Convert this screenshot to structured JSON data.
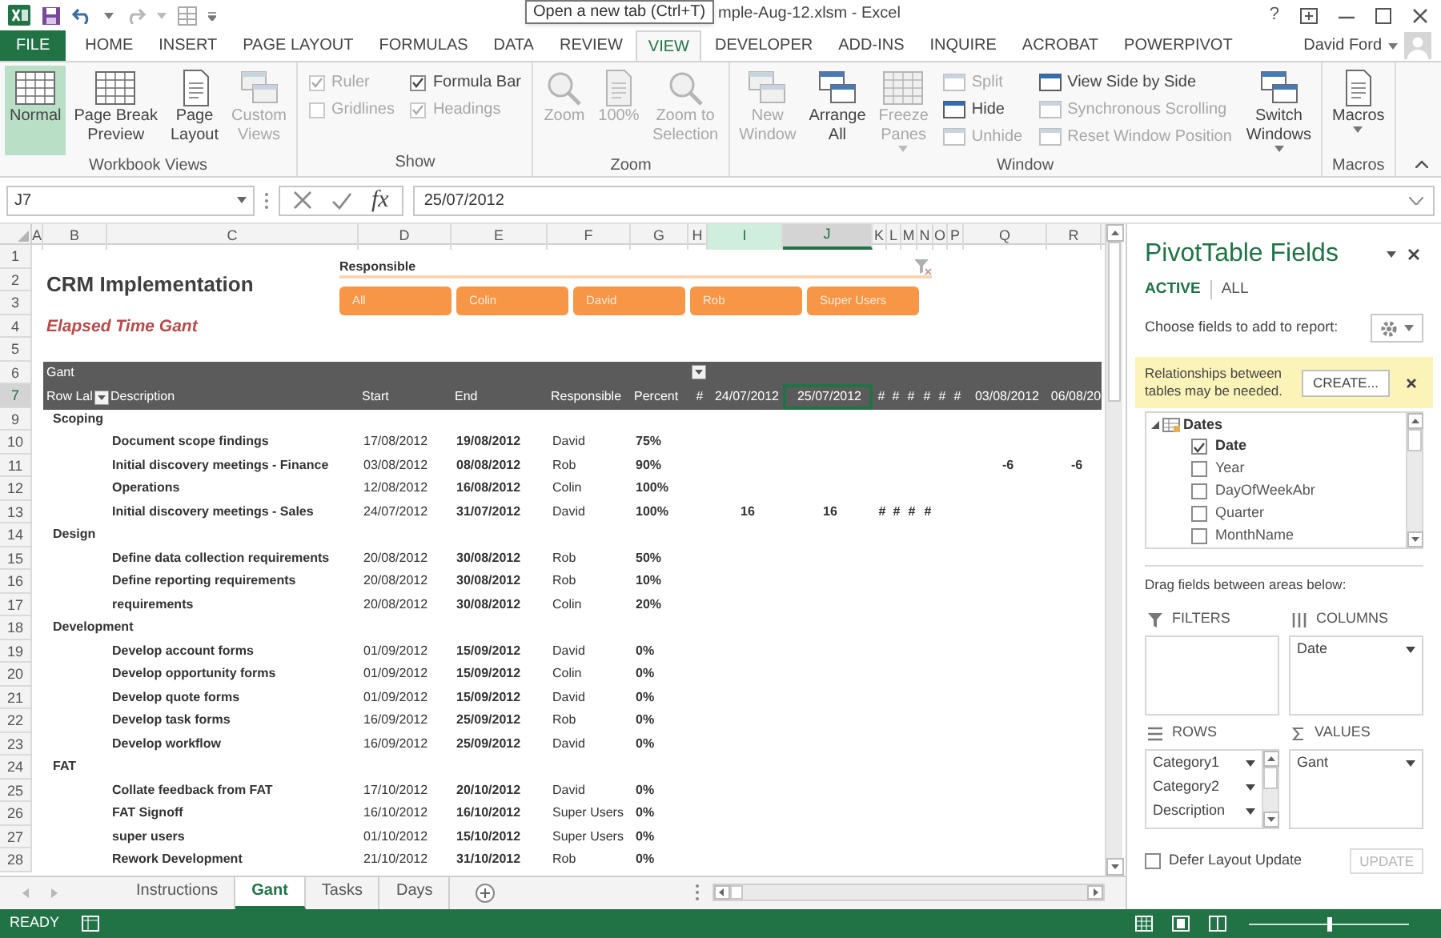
{
  "title_bar": {
    "tooltip": "Open a new tab (Ctrl+T)",
    "title": "mple-Aug-12.xlsm - Excel",
    "help": "?"
  },
  "tabs": [
    {
      "label": "FILE",
      "kind": "file",
      "selected": false
    },
    {
      "label": "HOME",
      "kind": "tab",
      "selected": false
    },
    {
      "label": "INSERT",
      "kind": "tab",
      "selected": false
    },
    {
      "label": "PAGE LAYOUT",
      "kind": "tab",
      "selected": false
    },
    {
      "label": "FORMULAS",
      "kind": "tab",
      "selected": false
    },
    {
      "label": "DATA",
      "kind": "tab",
      "selected": false
    },
    {
      "label": "REVIEW",
      "kind": "tab",
      "selected": false
    },
    {
      "label": "VIEW",
      "kind": "tab",
      "selected": true
    },
    {
      "label": "DEVELOPER",
      "kind": "tab",
      "selected": false
    },
    {
      "label": "ADD-INS",
      "kind": "tab",
      "selected": false
    },
    {
      "label": "INQUIRE",
      "kind": "tab",
      "selected": false
    },
    {
      "label": "ACROBAT",
      "kind": "tab",
      "selected": false
    },
    {
      "label": "POWERPIVOT",
      "kind": "tab",
      "selected": false
    }
  ],
  "user": {
    "name": "David Ford"
  },
  "ribbon": {
    "groups": [
      {
        "label": "Workbook Views",
        "items": [
          {
            "kind": "large",
            "lines": [
              "Normal"
            ],
            "selected": true,
            "disabled": false
          },
          {
            "kind": "large",
            "lines": [
              "Page Break",
              "Preview"
            ],
            "selected": false,
            "disabled": false
          },
          {
            "kind": "large",
            "lines": [
              "Page",
              "Layout"
            ],
            "selected": false,
            "disabled": false
          },
          {
            "kind": "large",
            "lines": [
              "Custom",
              "Views"
            ],
            "selected": false,
            "disabled": true
          }
        ]
      },
      {
        "label": "Show",
        "items": [
          {
            "kind": "checkbox",
            "label": "Ruler",
            "checked": true,
            "disabled": true
          },
          {
            "kind": "checkbox",
            "label": "Gridlines",
            "checked": false,
            "disabled": true
          },
          {
            "kind": "checkbox",
            "label": "Formula Bar",
            "checked": true,
            "disabled": false
          },
          {
            "kind": "checkbox",
            "label": "Headings",
            "checked": true,
            "disabled": true
          }
        ]
      },
      {
        "label": "Zoom",
        "items": [
          {
            "kind": "large",
            "lines": [
              "Zoom"
            ],
            "selected": false,
            "disabled": true
          },
          {
            "kind": "large",
            "lines": [
              "100%"
            ],
            "selected": false,
            "disabled": true
          },
          {
            "kind": "large",
            "lines": [
              "Zoom to",
              "Selection"
            ],
            "selected": false,
            "disabled": true
          }
        ]
      },
      {
        "label": "Window",
        "items": [
          {
            "kind": "large",
            "lines": [
              "New",
              "Window"
            ],
            "selected": false,
            "disabled": true
          },
          {
            "kind": "large",
            "lines": [
              "Arrange",
              "All"
            ],
            "selected": false,
            "disabled": false
          },
          {
            "kind": "large",
            "lines": [
              "Freeze",
              "Panes"
            ],
            "selected": false,
            "disabled": true,
            "dropdown": true
          },
          {
            "kind": "small",
            "label": "Split",
            "disabled": true
          },
          {
            "kind": "small",
            "label": "Hide",
            "disabled": false
          },
          {
            "kind": "small",
            "label": "Unhide",
            "disabled": true
          },
          {
            "kind": "small",
            "label": "View Side by Side",
            "disabled": false
          },
          {
            "kind": "small",
            "label": "Synchronous Scrolling",
            "disabled": true
          },
          {
            "kind": "small",
            "label": "Reset Window Position",
            "disabled": true
          },
          {
            "kind": "large",
            "lines": [
              "Switch",
              "Windows"
            ],
            "selected": false,
            "disabled": false,
            "dropdown": true
          }
        ]
      },
      {
        "label": "Macros",
        "items": [
          {
            "kind": "large",
            "lines": [
              "Macros"
            ],
            "selected": false,
            "disabled": false,
            "dropdown": true
          }
        ]
      }
    ]
  },
  "formula_bar": {
    "name_box": "J7",
    "function_label": "fx",
    "value": "25/07/2012"
  },
  "slicer": {
    "title": "Responsible",
    "buttons": [
      {
        "label": "All",
        "selected": true
      },
      {
        "label": "Colin",
        "selected": true
      },
      {
        "label": "David",
        "selected": true
      },
      {
        "label": "Rob",
        "selected": true
      },
      {
        "label": "Super Users",
        "selected": true
      }
    ]
  },
  "sheet": {
    "columns": [
      {
        "label": "A",
        "selected": false,
        "highlighted": false
      },
      {
        "label": "B",
        "selected": false,
        "highlighted": false
      },
      {
        "label": "C",
        "selected": false,
        "highlighted": false
      },
      {
        "label": "D",
        "selected": false,
        "highlighted": false
      },
      {
        "label": "E",
        "selected": false,
        "highlighted": false
      },
      {
        "label": "F",
        "selected": false,
        "highlighted": false
      },
      {
        "label": "G",
        "selected": false,
        "highlighted": false
      },
      {
        "label": "H",
        "selected": false,
        "highlighted": false
      },
      {
        "label": "I",
        "selected": false,
        "highlighted": true
      },
      {
        "label": "J",
        "selected": true,
        "highlighted": false
      },
      {
        "label": "K",
        "selected": false,
        "highlighted": false
      },
      {
        "label": "L",
        "selected": false,
        "highlighted": false
      },
      {
        "label": "M",
        "selected": false,
        "highlighted": false
      },
      {
        "label": "N",
        "selected": false,
        "highlighted": false
      },
      {
        "label": "O",
        "selected": false,
        "highlighted": false
      },
      {
        "label": "P",
        "selected": false,
        "highlighted": false
      },
      {
        "label": "Q",
        "selected": false,
        "highlighted": false
      },
      {
        "label": "R",
        "selected": false,
        "highlighted": false
      }
    ],
    "rows": [
      {
        "number": "1",
        "kind": "blank",
        "selected": false
      },
      {
        "number": "2",
        "kind": "title",
        "selected": false,
        "b": "CRM Implementation"
      },
      {
        "number": "3",
        "kind": "blank",
        "selected": false
      },
      {
        "number": "4",
        "kind": "subtitle",
        "selected": false,
        "b": "Elapsed Time Gant"
      },
      {
        "number": "5",
        "kind": "blank",
        "selected": false
      },
      {
        "number": "6",
        "kind": "header_top",
        "selected": false,
        "b": "Gant"
      },
      {
        "number": "7",
        "kind": "header",
        "selected": true,
        "b": "Row Lal",
        "c": "Description",
        "d": "Start",
        "e": "End",
        "f": "Responsible",
        "g": "Percent",
        "h": "#",
        "i": "24/07/2012",
        "j": "25/07/2012",
        "k": "#",
        "l": "#",
        "m": "#",
        "n": "#",
        "o": "#",
        "p": "#",
        "q": "03/08/2012",
        "r": "06/08/20"
      },
      {
        "number": "9",
        "kind": "group",
        "selected": false,
        "b": "Scoping"
      },
      {
        "number": "10",
        "kind": "task",
        "selected": false,
        "c": "Document scope findings",
        "d": "17/08/2012",
        "e": "19/08/2012",
        "f": "David",
        "g": "75%"
      },
      {
        "number": "11",
        "kind": "task",
        "selected": false,
        "c": "Initial discovery meetings - Finance",
        "d": "03/08/2012",
        "e": "08/08/2012",
        "f": "Rob",
        "g": "90%",
        "q": "-6",
        "r": "-6"
      },
      {
        "number": "12",
        "kind": "task",
        "selected": false,
        "c": "Operations",
        "d": "12/08/2012",
        "e": "16/08/2012",
        "f": "Colin",
        "g": "100%"
      },
      {
        "number": "13",
        "kind": "task",
        "selected": false,
        "c": "Initial discovery meetings - Sales",
        "d": "24/07/2012",
        "e": "31/07/2012",
        "f": "David",
        "g": "100%",
        "i": "16",
        "j": "16",
        "k": "#",
        "l": "#",
        "m": "#",
        "n": "#"
      },
      {
        "number": "14",
        "kind": "group",
        "selected": false,
        "b": "Design"
      },
      {
        "number": "15",
        "kind": "task",
        "selected": false,
        "c": "Define data collection requirements",
        "d": "20/08/2012",
        "e": "30/08/2012",
        "f": "Rob",
        "g": "50%"
      },
      {
        "number": "16",
        "kind": "task",
        "selected": false,
        "c": "Define reporting requirements",
        "d": "20/08/2012",
        "e": "30/08/2012",
        "f": "Rob",
        "g": "10%"
      },
      {
        "number": "17",
        "kind": "task",
        "selected": false,
        "c": "requirements",
        "d": "20/08/2012",
        "e": "30/08/2012",
        "f": "Colin",
        "g": "20%"
      },
      {
        "number": "18",
        "kind": "group",
        "selected": false,
        "b": "Development"
      },
      {
        "number": "19",
        "kind": "task",
        "selected": false,
        "c": "Develop account forms",
        "d": "01/09/2012",
        "e": "15/09/2012",
        "f": "David",
        "g": "0%"
      },
      {
        "number": "20",
        "kind": "task",
        "selected": false,
        "c": "Develop opportunity forms",
        "d": "01/09/2012",
        "e": "15/09/2012",
        "f": "Colin",
        "g": "0%"
      },
      {
        "number": "21",
        "kind": "task",
        "selected": false,
        "c": "Develop quote forms",
        "d": "01/09/2012",
        "e": "15/09/2012",
        "f": "David",
        "g": "0%"
      },
      {
        "number": "22",
        "kind": "task",
        "selected": false,
        "c": "Develop task forms",
        "d": "16/09/2012",
        "e": "25/09/2012",
        "f": "Rob",
        "g": "0%"
      },
      {
        "number": "23",
        "kind": "task",
        "selected": false,
        "c": "Develop workflow",
        "d": "16/09/2012",
        "e": "25/09/2012",
        "f": "David",
        "g": "0%"
      },
      {
        "number": "24",
        "kind": "group",
        "selected": false,
        "b": "FAT"
      },
      {
        "number": "25",
        "kind": "task",
        "selected": false,
        "c": "Collate feedback from FAT",
        "d": "17/10/2012",
        "e": "20/10/2012",
        "f": "David",
        "g": "0%"
      },
      {
        "number": "26",
        "kind": "task",
        "selected": false,
        "c": "FAT Signoff",
        "d": "16/10/2012",
        "e": "16/10/2012",
        "f": "Super Users",
        "g": "0%"
      },
      {
        "number": "27",
        "kind": "task",
        "selected": false,
        "c": "super users",
        "d": "01/10/2012",
        "e": "15/10/2012",
        "f": "Super Users",
        "g": "0%"
      },
      {
        "number": "28",
        "kind": "task",
        "selected": false,
        "c": "Rework Development",
        "d": "21/10/2012",
        "e": "31/10/2012",
        "f": "Rob",
        "g": "0%"
      }
    ]
  },
  "sheet_tabs": [
    {
      "label": "Instructions",
      "selected": false
    },
    {
      "label": "Gant",
      "selected": true
    },
    {
      "label": "Tasks",
      "selected": false
    },
    {
      "label": "Days",
      "selected": false
    }
  ],
  "status_bar": {
    "status": "READY",
    "zoom_slider": {
      "level": 0.5
    }
  },
  "pivot_fields": {
    "title": "PivotTable Fields",
    "tabs": [
      {
        "label": "ACTIVE",
        "selected": true
      },
      {
        "label": "ALL",
        "selected": false
      }
    ],
    "prompt": "Choose fields to add to report:",
    "notice": {
      "text": "Relationships between tables may be needed.",
      "button": "CREATE..."
    },
    "field_tree": {
      "label": "Dates",
      "expanded": true,
      "fields": [
        {
          "label": "Date",
          "checked": true
        },
        {
          "label": "Year",
          "checked": false
        },
        {
          "label": "DayOfWeekAbr",
          "checked": false
        },
        {
          "label": "Quarter",
          "checked": false
        },
        {
          "label": "MonthName",
          "checked": false
        }
      ]
    },
    "drag_hint": "Drag fields between areas below:",
    "areas": [
      {
        "kind": "filters",
        "label": "FILTERS"
      },
      {
        "kind": "columns",
        "label": "COLUMNS",
        "items": [
          {
            "label": "Date"
          }
        ]
      },
      {
        "kind": "rows",
        "label": "ROWS",
        "items": [
          {
            "label": "Category1"
          },
          {
            "label": "Category2"
          },
          {
            "label": "Description"
          }
        ]
      },
      {
        "kind": "values",
        "label": "VALUES",
        "items": [
          {
            "label": "Gant"
          }
        ]
      }
    ],
    "defer": {
      "label": "Defer Layout Update",
      "checked": false
    },
    "update_button": {
      "label": "UPDATE",
      "disabled": true
    }
  }
}
